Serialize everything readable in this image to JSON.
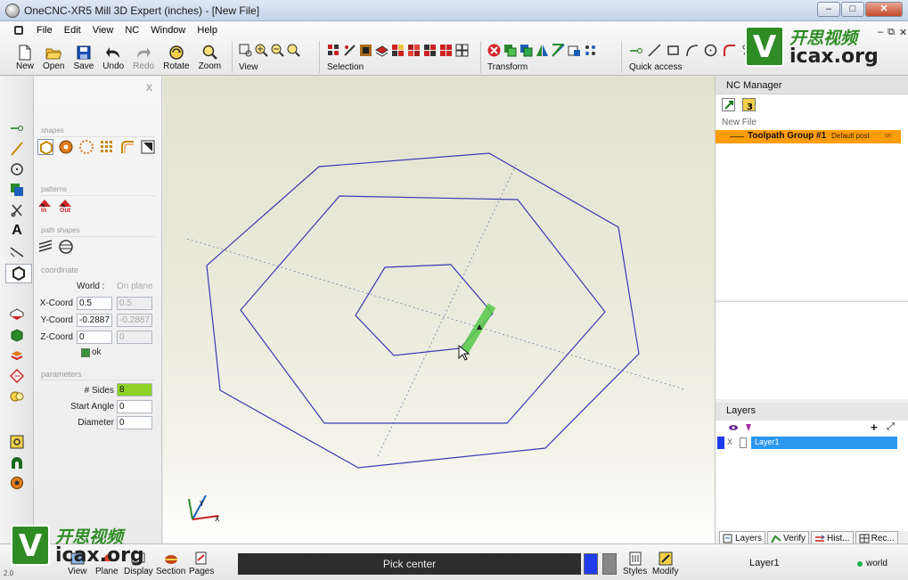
{
  "window": {
    "title": "OneCNC-XR5 Mill 3D Expert (inches) - [New File]",
    "minimize": "–",
    "maximize": "□",
    "close": "✕"
  },
  "menu": {
    "items": [
      "File",
      "Edit",
      "View",
      "NC",
      "Window",
      "Help"
    ],
    "mdi": [
      "–",
      "⧉",
      "✕"
    ]
  },
  "toolbar": {
    "file_buttons": [
      {
        "label": "New",
        "icon": "new-file-icon",
        "disabled": false
      },
      {
        "label": "Open",
        "icon": "open-folder-icon",
        "disabled": false
      },
      {
        "label": "Save",
        "icon": "save-disk-icon",
        "disabled": false
      },
      {
        "label": "Undo",
        "icon": "undo-arrow-icon",
        "disabled": false
      },
      {
        "label": "Redo",
        "icon": "redo-arrow-icon",
        "disabled": true
      },
      {
        "label": "Rotate",
        "icon": "rotate-icon",
        "disabled": false
      },
      {
        "label": "Zoom",
        "icon": "zoom-icon",
        "disabled": false
      }
    ],
    "group_labels": {
      "view": "View",
      "selection": "Selection",
      "transform": "Transform",
      "quick_access": "Quick access"
    }
  },
  "panel": {
    "close": "x",
    "sections": {
      "shapes": "shapes",
      "patterns": "patterns",
      "path_shapes": "path shapes",
      "coordinate": "coordinate",
      "parameters": "parameters"
    },
    "pattern_labels": [
      "In",
      "Out"
    ],
    "coordinate": {
      "world_label": "World :",
      "onplane_label": "On plane",
      "rows": [
        {
          "label": "X-Coord",
          "world": "0.5",
          "plane": "0.5"
        },
        {
          "label": "Y-Coord",
          "world": "-0.2887",
          "plane": "-0.2887"
        },
        {
          "label": "Z-Coord",
          "world": "0",
          "plane": "0"
        }
      ],
      "ok_label": "ok"
    },
    "parameters": [
      {
        "label": "# Sides",
        "value": "8",
        "highlight": true
      },
      {
        "label": "Start Angle",
        "value": "0",
        "highlight": false
      },
      {
        "label": "Diameter",
        "value": "0",
        "highlight": false
      }
    ]
  },
  "nc_manager": {
    "title": "NC Manager",
    "file_name": "New File",
    "toolpath_group": {
      "name": "Toolpath Group #1",
      "post": "Default post",
      "state": "on"
    }
  },
  "layers": {
    "title": "Layers",
    "add": "+",
    "expand": "⤢",
    "row": {
      "visible": "X",
      "name": "Layer1"
    },
    "tabs": [
      "Layers",
      "Verify",
      "Hist...",
      "Rec..."
    ]
  },
  "status": {
    "prompt": "Pick center",
    "buttons": [
      "View",
      "Plane",
      "Display",
      "Section",
      "Pages",
      "Styles",
      "Modify"
    ],
    "layer": "Layer1",
    "mode": "world",
    "coord_readout": "2.0",
    "primary_color": "#1f3cf0",
    "secondary_color": "#888888"
  },
  "viewport": {
    "triad_labels": [
      "Y",
      "X"
    ]
  },
  "colors": {
    "toolpath_highlight": "#ff9d0b",
    "layer_selected": "#2b97ef",
    "geometry_line": "#3a3ab4",
    "construction_line": "#6d7fa8",
    "selection_green": "#57c94a"
  },
  "watermark": {
    "mark": "V",
    "chinese": "开思视频",
    "site": "icax.org"
  }
}
